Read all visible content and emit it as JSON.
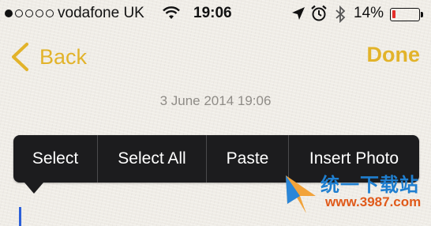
{
  "status_bar": {
    "signal_filled": 1,
    "signal_total": 5,
    "carrier": "vodafone UK",
    "time": "19:06",
    "battery_percent": "14%",
    "battery_level": 0.14,
    "battery_color": "#e4302b",
    "icons": [
      "wifi-icon",
      "location-arrow-icon",
      "alarm-clock-icon",
      "bluetooth-icon",
      "battery-icon"
    ]
  },
  "nav": {
    "back_label": "Back",
    "done_label": "Done",
    "accent_color": "#e2b32a"
  },
  "note": {
    "date": "3 June 2014 19:06"
  },
  "context_menu": {
    "items": [
      "Select",
      "Select All",
      "Paste",
      "Insert Photo"
    ]
  },
  "watermark": {
    "title": "统一下载站",
    "url": "www.3987.com"
  }
}
